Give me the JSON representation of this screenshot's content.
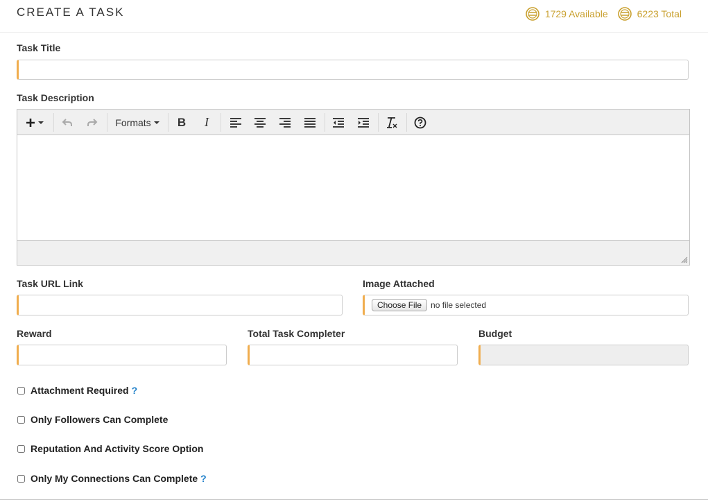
{
  "header": {
    "title": "CREATE A TASK",
    "available": "1729 Available",
    "total": "6223 Total",
    "coin_color": "#c9a02e"
  },
  "form": {
    "task_title_label": "Task Title",
    "task_title_value": "",
    "task_description_label": "Task Description",
    "toolbar": {
      "insert_icon": "plus-icon",
      "undo_icon": "undo-icon",
      "redo_icon": "redo-icon",
      "formats_label": "Formats",
      "bold_label": "B",
      "italic_label": "I",
      "clear_format_icon": "clear-formatting-icon",
      "help_icon": "help-circle-icon"
    },
    "task_url_label": "Task URL Link",
    "task_url_value": "",
    "image_label": "Image Attached",
    "choose_file_label": "Choose File",
    "file_status": "no file selected",
    "reward_label": "Reward",
    "reward_value": "",
    "completer_label": "Total Task Completer",
    "completer_value": "",
    "budget_label": "Budget",
    "budget_value": "",
    "accent_color": "#f0ad4e"
  },
  "options": {
    "attachment_required": "Attachment Required",
    "followers_only": "Only Followers Can Complete",
    "reputation_option": "Reputation And Activity Score Option",
    "connections_only": "Only My Connections Can Complete",
    "help_mark": "?"
  }
}
